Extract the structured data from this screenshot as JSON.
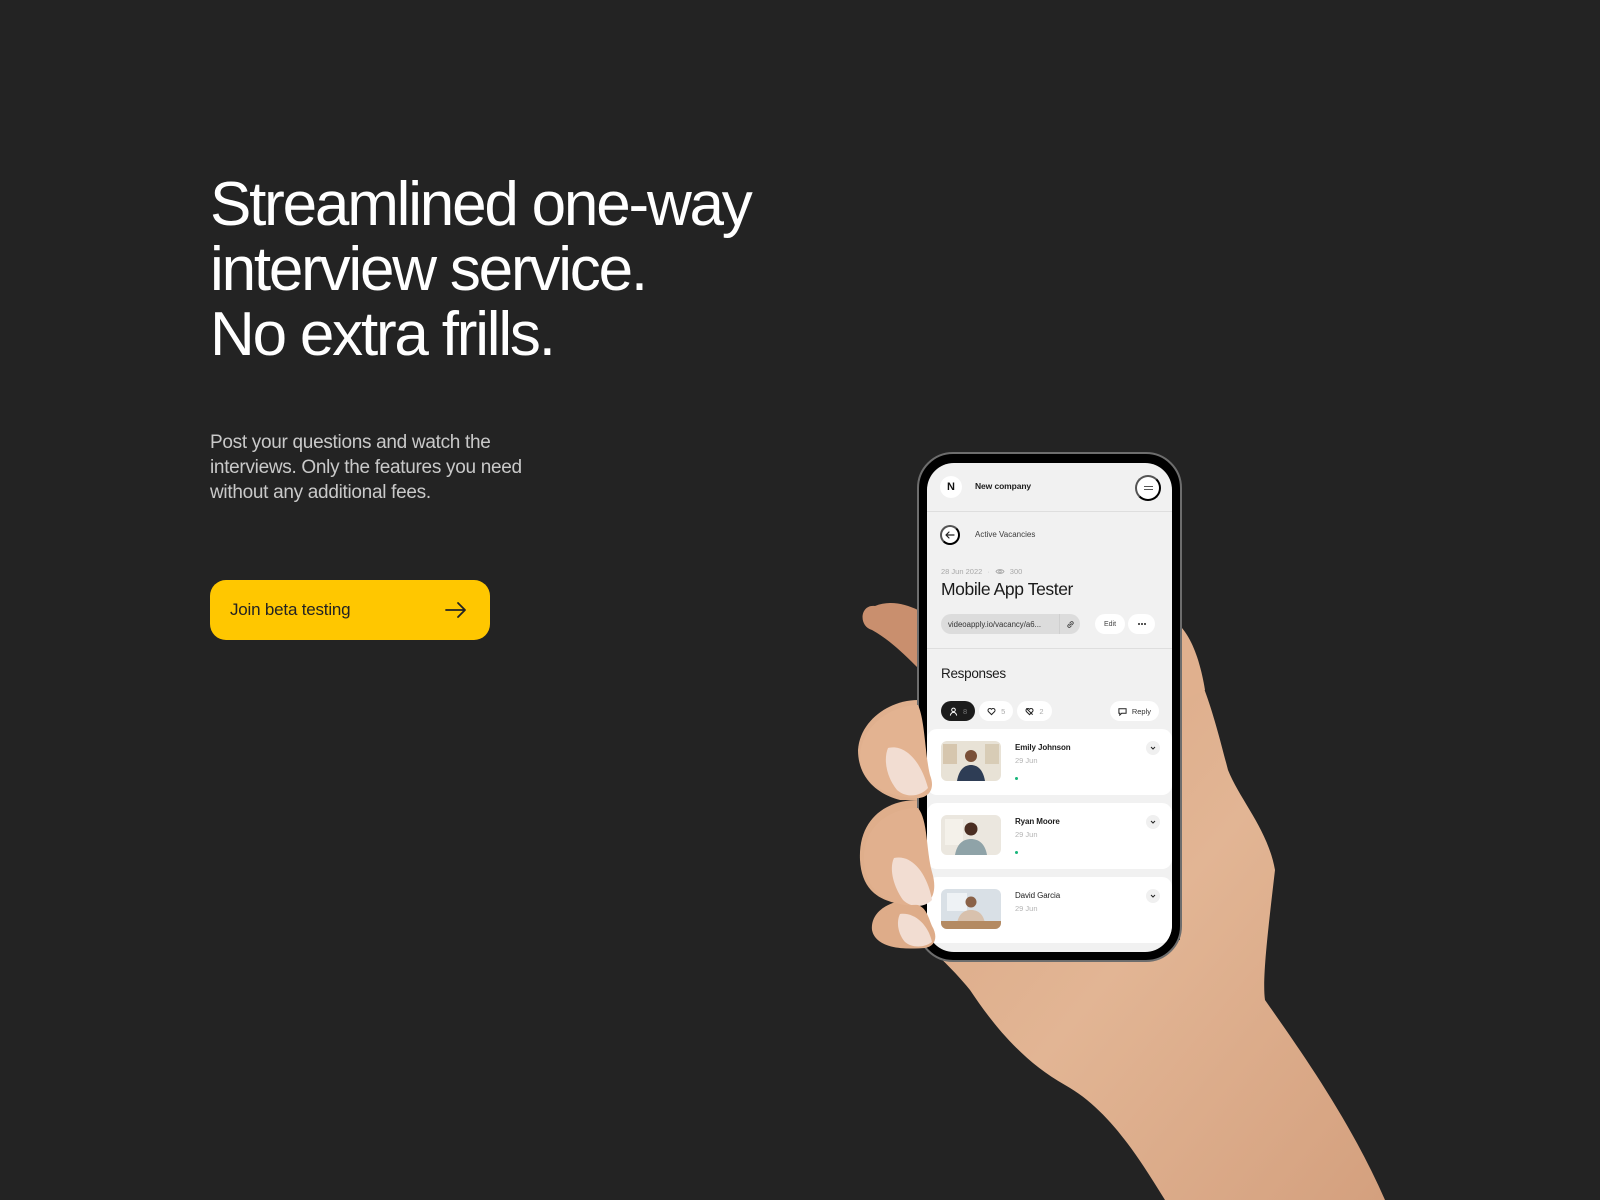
{
  "hero": {
    "headline_lines": [
      "Streamlined one-way",
      "interview service.",
      "No extra frills."
    ],
    "subtext_lines": [
      "Post your questions and watch the",
      "interviews. Only the features you need",
      "without any additional fees."
    ],
    "cta": {
      "label": "Join beta testing",
      "icon": "arrow-right-icon",
      "color": "#FFC700"
    }
  },
  "phone": {
    "topbar": {
      "avatar_letter": "N",
      "company": "New company",
      "menu_icon": "menu-icon"
    },
    "breadcrumb": {
      "back_icon": "arrow-left-icon",
      "label": "Active Vacancies"
    },
    "vacancy": {
      "date": "28 Jun 2022",
      "separator": "·",
      "views_icon": "eye-icon",
      "views": "300",
      "title": "Mobile App Tester",
      "link": "videoapply.io/vacancy/a6...",
      "link_icon": "link-icon",
      "edit_label": "Edit",
      "more_icon": "more-icon"
    },
    "responses": {
      "title": "Responses",
      "filters": [
        {
          "icon": "person-icon",
          "count": "8",
          "active": true
        },
        {
          "icon": "heart-icon",
          "count": "5",
          "active": false
        },
        {
          "icon": "heart-off-icon",
          "count": "2",
          "active": false
        }
      ],
      "reply_label": "Reply",
      "reply_icon": "chat-icon",
      "candidates": [
        {
          "name": "Emily Johnson",
          "date": "29 Jun",
          "status_color": "#18B57A"
        },
        {
          "name": "Ryan Moore",
          "date": "29 Jun",
          "status_color": "#18B57A"
        },
        {
          "name": "David Garcia",
          "date": "29 Jun"
        }
      ]
    }
  }
}
